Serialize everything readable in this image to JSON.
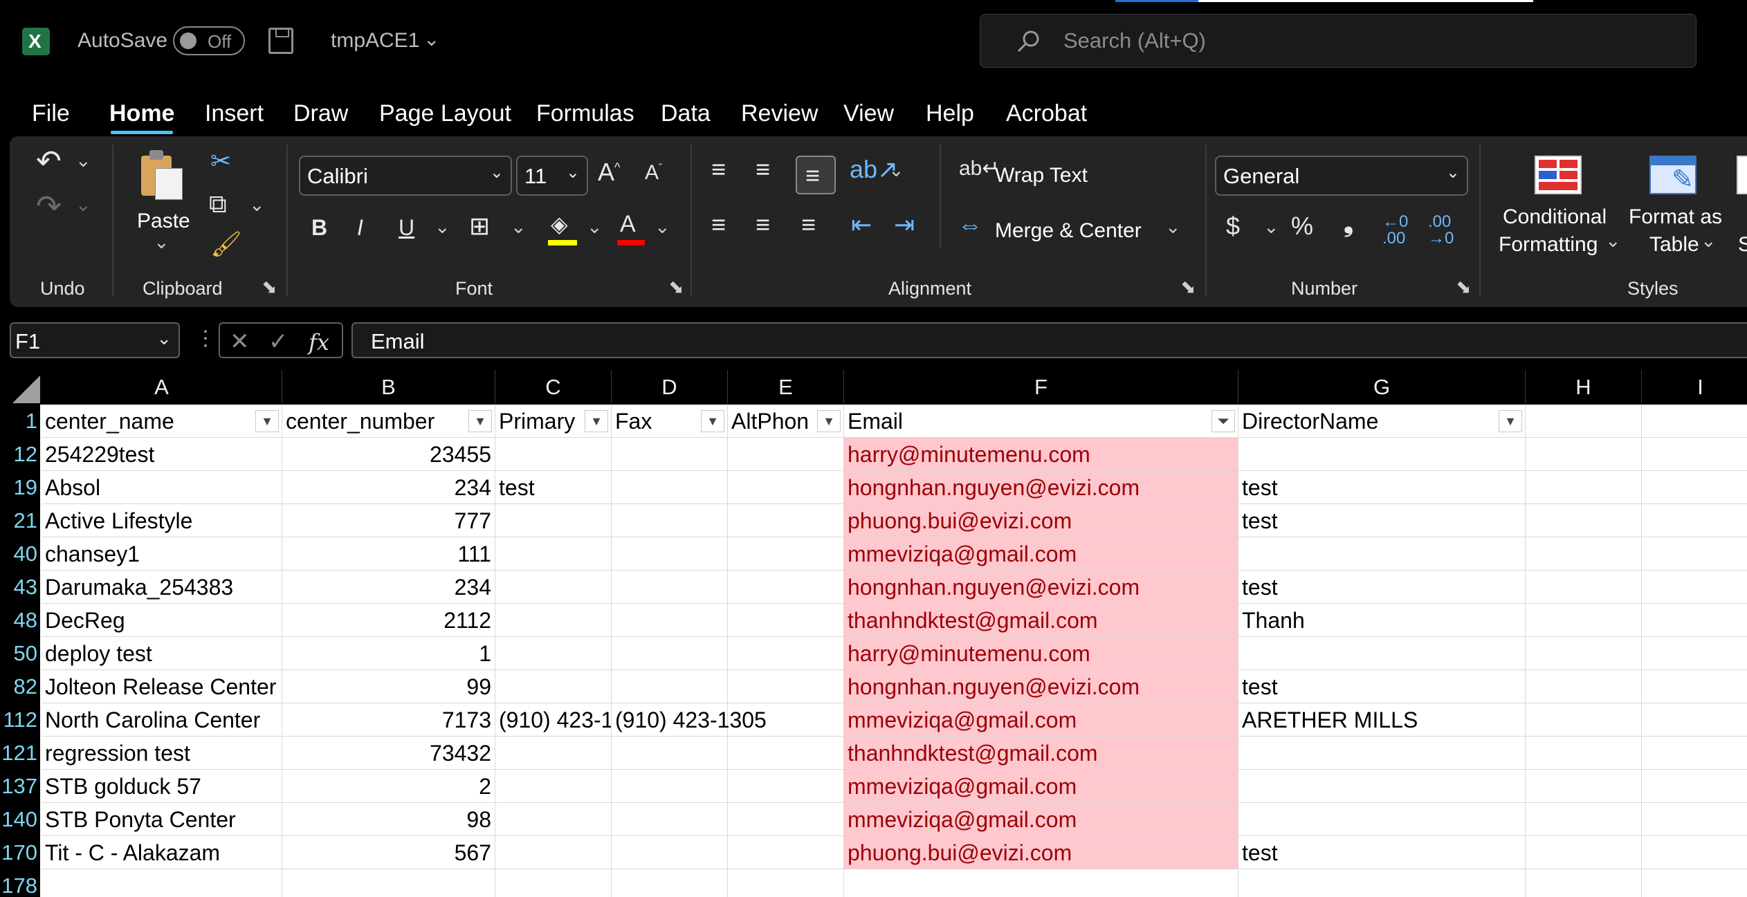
{
  "app": {
    "autosave_label": "AutoSave",
    "autosave_state": "Off",
    "file_name": "tmpACE1",
    "search_placeholder": "Search (Alt+Q)"
  },
  "menu": [
    "File",
    "Home",
    "Insert",
    "Draw",
    "Page Layout",
    "Formulas",
    "Data",
    "Review",
    "View",
    "Help",
    "Acrobat"
  ],
  "active_menu": "Home",
  "ribbon": {
    "undo_group": "Undo",
    "clipboard_group": "Clipboard",
    "paste_label": "Paste",
    "font_group": "Font",
    "font_name": "Calibri",
    "font_size": "11",
    "alignment_group": "Alignment",
    "wrap_text": "Wrap Text",
    "merge_center": "Merge & Center",
    "number_group": "Number",
    "number_format": "General",
    "styles_group": "Styles",
    "conditional_formatting": [
      "Conditional",
      "Formatting"
    ],
    "format_as_table": [
      "Format as",
      "Table"
    ],
    "cell_styles_partial": "St"
  },
  "formula_bar": {
    "name_box": "F1",
    "content": "Email",
    "fx": "fx"
  },
  "colors": {
    "accent": "#217346",
    "progress": "#1e6fd9",
    "email_fill": "#ffc7ce",
    "email_text": "#9c0006",
    "row_number": "#7fd6f0",
    "font_highlight": "#ffff00",
    "font_color": "#ff0000"
  },
  "columns": [
    "A",
    "B",
    "C",
    "D",
    "E",
    "F",
    "G",
    "H",
    "I"
  ],
  "headers": [
    "center_name",
    "center_number",
    "Primary",
    "Fax",
    "AltPhon",
    "Email",
    "DirectorName"
  ],
  "rows": [
    {
      "row": "12",
      "cells": [
        "254229test",
        "23455",
        "",
        "",
        "",
        "harry@minutemenu.com",
        ""
      ]
    },
    {
      "row": "19",
      "cells": [
        "Absol",
        "234",
        "test",
        "",
        "",
        "hongnhan.nguyen@evizi.com",
        "test"
      ]
    },
    {
      "row": "21",
      "cells": [
        "Active Lifestyle",
        "777",
        "",
        "",
        "",
        "phuong.bui@evizi.com",
        "test"
      ]
    },
    {
      "row": "40",
      "cells": [
        "chansey1",
        "111",
        "",
        "",
        "",
        "mmeviziqa@gmail.com",
        ""
      ]
    },
    {
      "row": "43",
      "cells": [
        "Darumaka_254383",
        "234",
        "",
        "",
        "",
        "hongnhan.nguyen@evizi.com",
        "test"
      ]
    },
    {
      "row": "48",
      "cells": [
        "DecReg",
        "2112",
        "",
        "",
        "",
        "thanhndktest@gmail.com",
        "Thanh"
      ]
    },
    {
      "row": "50",
      "cells": [
        "deploy test",
        "1",
        "",
        "",
        "",
        "harry@minutemenu.com",
        ""
      ]
    },
    {
      "row": "82",
      "cells": [
        "Jolteon Release Center",
        "99",
        "",
        "",
        "",
        "hongnhan.nguyen@evizi.com",
        "test"
      ]
    },
    {
      "row": "112",
      "cells": [
        "North Carolina Center",
        "7173",
        "(910) 423-1",
        "(910) 423-1305",
        "",
        "mmeviziqa@gmail.com",
        "ARETHER MILLS"
      ]
    },
    {
      "row": "121",
      "cells": [
        "regression test",
        "73432",
        "",
        "",
        "",
        "thanhndktest@gmail.com",
        ""
      ]
    },
    {
      "row": "137",
      "cells": [
        "STB golduck 57",
        "2",
        "",
        "",
        "",
        "mmeviziqa@gmail.com",
        ""
      ]
    },
    {
      "row": "140",
      "cells": [
        "STB Ponyta Center",
        "98",
        "",
        "",
        "",
        "mmeviziqa@gmail.com",
        ""
      ]
    },
    {
      "row": "170",
      "cells": [
        "Tit - C - Alakazam",
        "567",
        "",
        "",
        "",
        "phuong.bui@evizi.com",
        "test"
      ]
    }
  ],
  "last_row": "178"
}
